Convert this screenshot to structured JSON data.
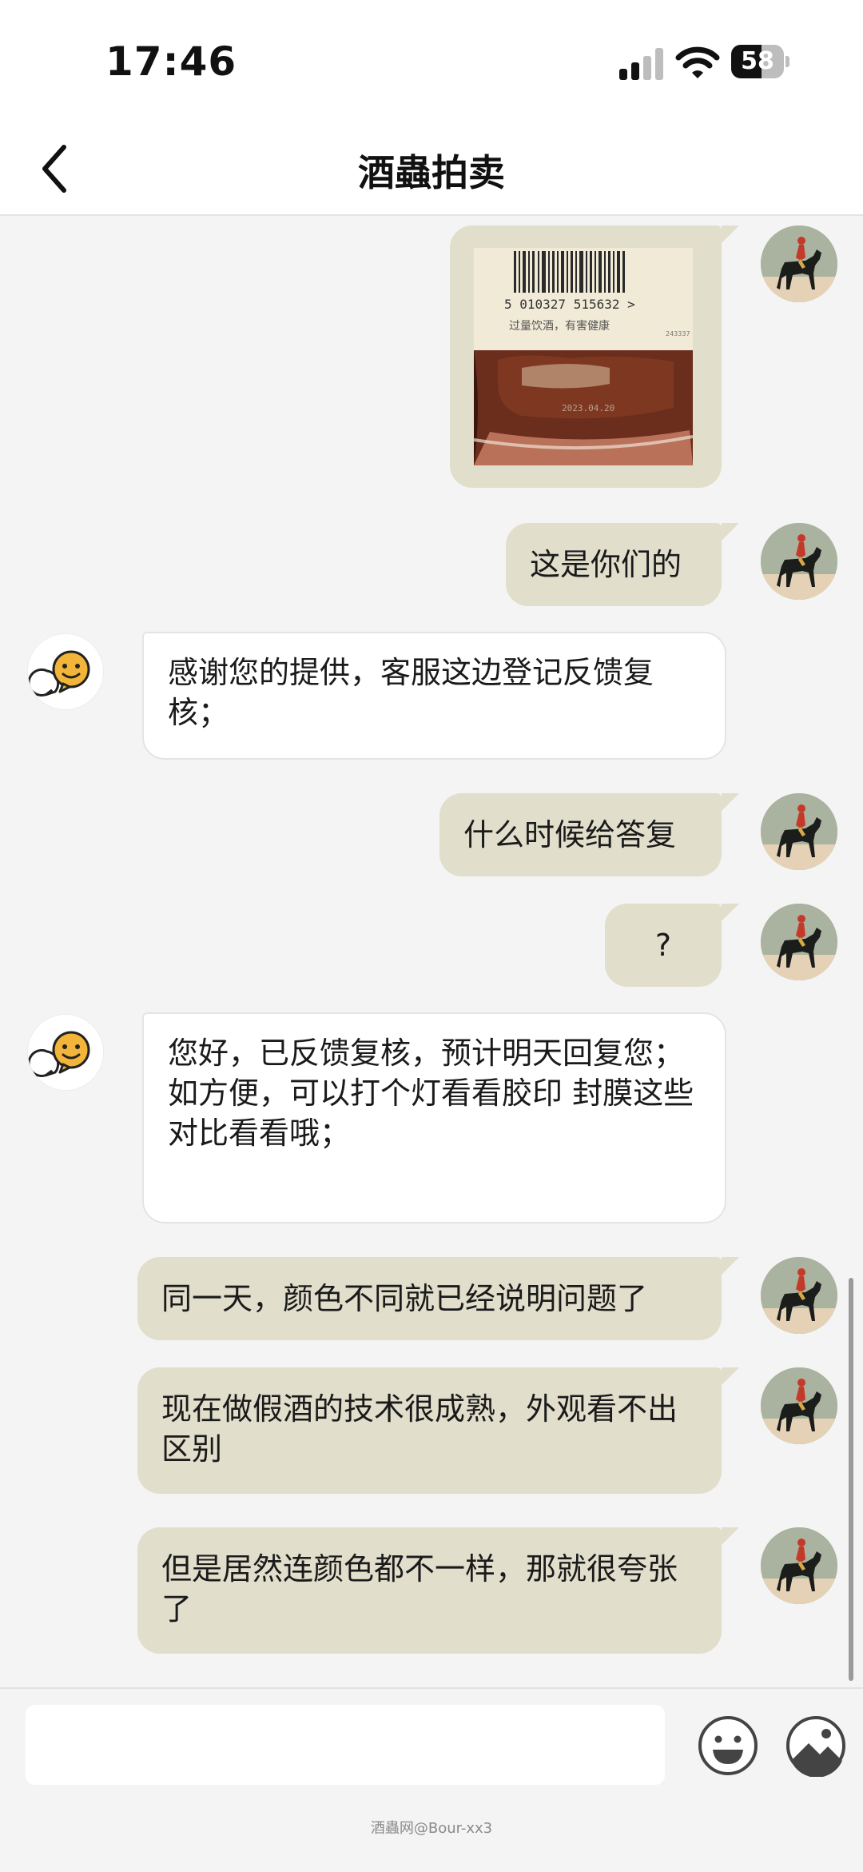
{
  "status_bar": {
    "time": "17:46",
    "battery": "58",
    "battery_level": 0.58
  },
  "header": {
    "title": "酒蟲拍卖"
  },
  "photo": {
    "barcode_number": "5 010327 515632 >",
    "warning_text": "过量饮酒，有害健康",
    "side_code": "243337",
    "print_text": "2023.04.20"
  },
  "messages": [
    {
      "sender": "user",
      "type": "image"
    },
    {
      "sender": "user",
      "text": "这是你们的"
    },
    {
      "sender": "agent",
      "text": "感谢您的提供，客服这边登记反馈复核；"
    },
    {
      "sender": "user",
      "text": "什么时候给答复"
    },
    {
      "sender": "user",
      "text": "?"
    },
    {
      "sender": "agent",
      "line1": "您好，已反馈复核，预计明天回复您；",
      "line2": "如方便，可以打个灯看看胶印 封膜这些对比看看哦；"
    },
    {
      "sender": "user",
      "text": "同一天，颜色不同就已经说明问题了"
    },
    {
      "sender": "user",
      "text": "现在做假酒的技术很成熟，外观看不出区别"
    },
    {
      "sender": "user",
      "text": "但是居然连颜色都不一样，那就很夸张了"
    }
  ],
  "input": {
    "placeholder": ""
  },
  "watermark": "酒蟲网@Bour-xx3",
  "colors": {
    "outgoing_bubble": "#e1decc",
    "incoming_bubble": "#ffffff",
    "background": "#f4f4f4",
    "agent_avatar": "#f2b53a"
  }
}
